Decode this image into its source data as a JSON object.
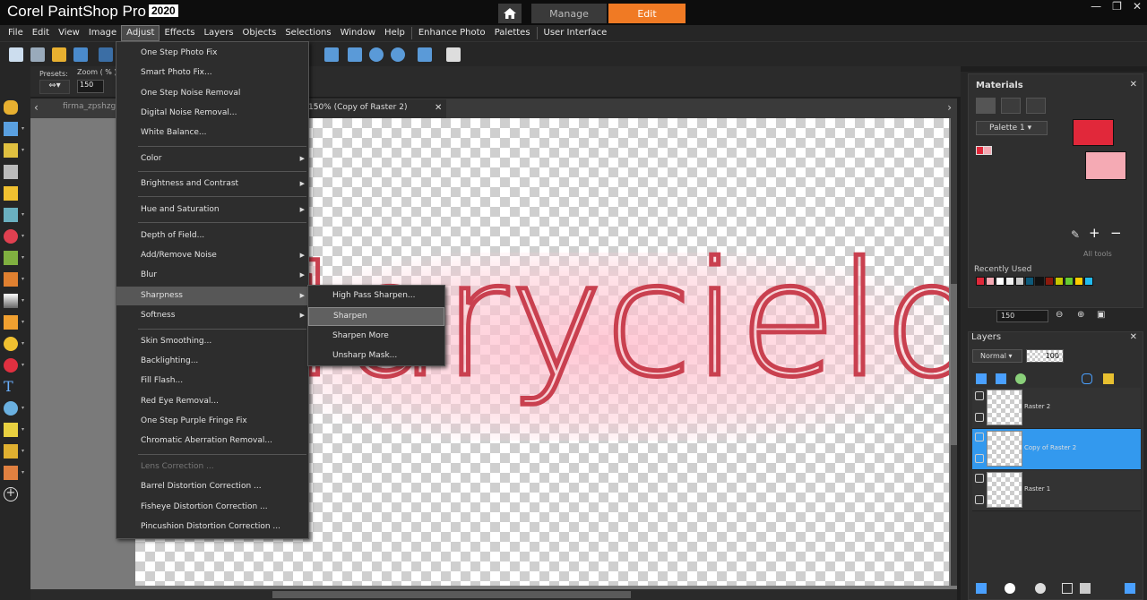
{
  "app": {
    "brand": "Corel PaintShop Pro",
    "version": "2020"
  },
  "modes": {
    "manage": "Manage",
    "edit": "Edit"
  },
  "menubar": {
    "items": [
      "File",
      "Edit",
      "View",
      "Image",
      "Adjust",
      "Effects",
      "Layers",
      "Objects",
      "Selections",
      "Window",
      "Help"
    ],
    "extra": [
      "Enhance Photo",
      "Palettes",
      "User Interface"
    ]
  },
  "tool_options": {
    "presets_label": "Presets:",
    "zoom_label": "Zoom ( % )",
    "zoom_value": "150"
  },
  "doc_tabs": {
    "inactive": "firma_zpshzgav",
    "active": "150% (Copy of Raster 2)"
  },
  "canvas": {
    "text": "Marycielo"
  },
  "adjust_menu": {
    "items": [
      "One Step Photo Fix",
      "Smart Photo Fix...",
      "One Step Noise Removal",
      "Digital Noise Removal...",
      "White Balance...",
      "Color",
      "Brightness and Contrast",
      "Hue and Saturation",
      "Depth of Field...",
      "Add/Remove Noise",
      "Blur",
      "Sharpness",
      "Softness",
      "Skin Smoothing...",
      "Backlighting...",
      "Fill Flash...",
      "Red Eye Removal...",
      "One Step Purple Fringe Fix",
      "Chromatic Aberration Removal...",
      "Lens Correction ...",
      "Barrel Distortion Correction ...",
      "Fisheye Distortion Correction ...",
      "Pincushion Distortion Correction ..."
    ]
  },
  "sharpness_menu": {
    "items": [
      "High Pass Sharpen...",
      "Sharpen",
      "Sharpen More",
      "Unsharp Mask..."
    ]
  },
  "materials": {
    "title": "Materials",
    "palette": "Palette 1",
    "all_tools": "All tools",
    "recently_used": "Recently Used",
    "fg_color": "#e1283a",
    "bg_color": "#f5aab4",
    "recent_colors": [
      "#e1283a",
      "#f5aab4",
      "#ffffff",
      "#f0f0f0",
      "#cccccc",
      "#0e5a7a",
      "#111111",
      "#8b1a0d",
      "#c8c800",
      "#66cc33",
      "#ffcc00",
      "#22bbee"
    ],
    "zoom_value": "150"
  },
  "layers": {
    "title": "Layers",
    "blend_mode": "Normal",
    "opacity": "100",
    "items": [
      "Raster 2",
      "Copy of Raster 2",
      "Raster 1"
    ]
  },
  "colors": {
    "accent": "#f07a24",
    "selection": "#3399ee"
  }
}
